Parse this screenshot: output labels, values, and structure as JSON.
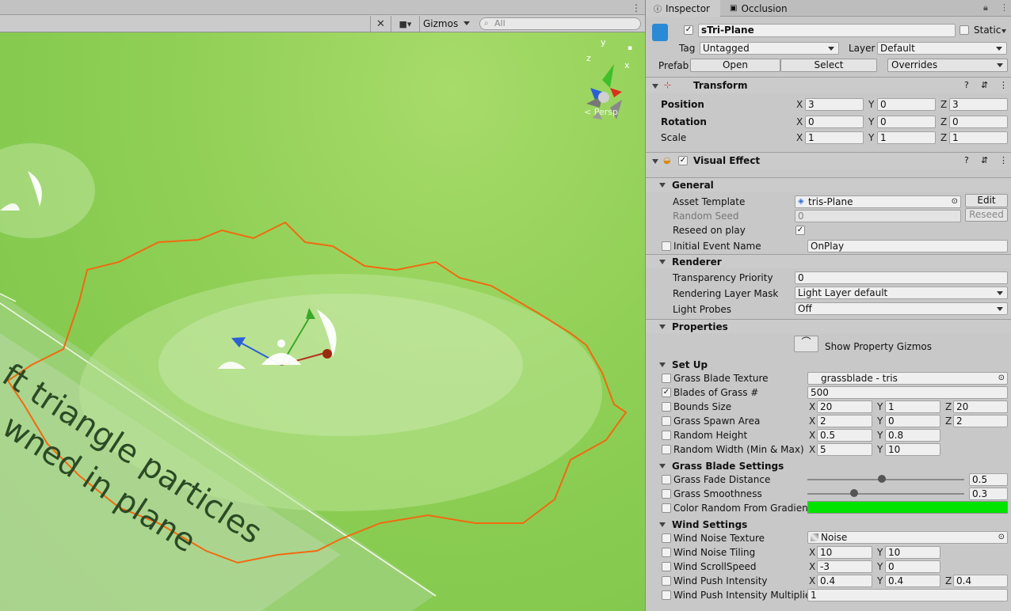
{
  "scene": {
    "gizmos_label": "Gizmos",
    "search_placeholder": "All",
    "persp_label": "< Persp",
    "axis_x": "x",
    "axis_y": "y",
    "axis_z": "z",
    "overlay_text_line1": "ft triangle particles",
    "overlay_text_line2": "wned in plane"
  },
  "inspector": {
    "tabs": [
      {
        "label": "Inspector",
        "icon": "info-icon"
      },
      {
        "label": "Occlusion",
        "icon": "occlusion-icon"
      }
    ],
    "object_name": "sTri-Plane",
    "static_label": "Static",
    "tag_label": "Tag",
    "tag_value": "Untagged",
    "layer_label": "Layer",
    "layer_value": "Default",
    "prefab_label": "Prefab",
    "open_label": "Open",
    "select_label": "Select",
    "overrides_label": "Overrides",
    "transform": {
      "title": "Transform",
      "position_label": "Position",
      "rotation_label": "Rotation",
      "scale_label": "Scale",
      "position": {
        "x": "3",
        "y": "0",
        "z": "3"
      },
      "rotation": {
        "x": "0",
        "y": "0",
        "z": "0"
      },
      "scale": {
        "x": "1",
        "y": "1",
        "z": "1"
      }
    },
    "visual_effect": {
      "title": "Visual Effect",
      "general": "General",
      "asset_template_label": "Asset Template",
      "asset_template_value": "tris-Plane",
      "edit_label": "Edit",
      "random_seed_label": "Random Seed",
      "random_seed_value": "0",
      "reseed_label": "Reseed",
      "reseed_on_play_label": "Reseed on play",
      "initial_event_label": "Initial Event Name",
      "initial_event_value": "OnPlay",
      "renderer": "Renderer",
      "transparency_label": "Transparency Priority",
      "transparency_value": "0",
      "rendering_mask_label": "Rendering Layer Mask",
      "rendering_mask_value": "Light Layer default",
      "light_probes_label": "Light Probes",
      "light_probes_value": "Off",
      "properties": "Properties",
      "show_gizmos_label": "Show Property Gizmos",
      "setup": "Set Up",
      "grass_texture_label": "Grass Blade Texture",
      "grass_texture_value": "grassblade - tris",
      "blades_label": "Blades of Grass #",
      "blades_value": "500",
      "bounds_label": "Bounds Size",
      "bounds": {
        "x": "20",
        "y": "1",
        "z": "20"
      },
      "spawn_label": "Grass Spawn Area",
      "spawn": {
        "x": "2",
        "y": "0",
        "z": "2"
      },
      "rand_height_label": "Random Height",
      "rand_height": {
        "x": "0.5",
        "y": "0.8"
      },
      "rand_width_label": "Random Width (Min & Max)",
      "rand_width": {
        "x": "5",
        "y": "10"
      },
      "blade_settings": "Grass Blade Settings",
      "fade_label": "Grass Fade Distance",
      "fade_value": "0.5",
      "fade_level": 0.5,
      "smooth_label": "Grass Smoothness",
      "smooth_value": "0.3",
      "smooth_level": 0.3,
      "color_gradient_label": "Color Random From Gradient",
      "gradient_color": "#00e400",
      "wind": "Wind Settings",
      "wind_noise_label": "Wind Noise Texture",
      "wind_noise_value": "Noise",
      "wind_tiling_label": "Wind Noise Tiling",
      "wind_tiling": {
        "x": "10",
        "y": "10"
      },
      "wind_scroll_label": "Wind ScrollSpeed",
      "wind_scroll": {
        "x": "-3",
        "y": "0"
      },
      "wind_push_label": "Wind Push Intensity",
      "wind_push": {
        "x": "0.4",
        "y": "0.4",
        "z": "0.4"
      },
      "wind_push_mult_label": "Wind Push Intensity Multiplier",
      "wind_push_mult_value": "1"
    },
    "axes": {
      "x": "X",
      "y": "Y",
      "z": "Z"
    }
  },
  "colors": {
    "selection_outline": "#f06a10",
    "scene_green": "#8fcf55",
    "accent_blue": "#2a6fd6"
  }
}
